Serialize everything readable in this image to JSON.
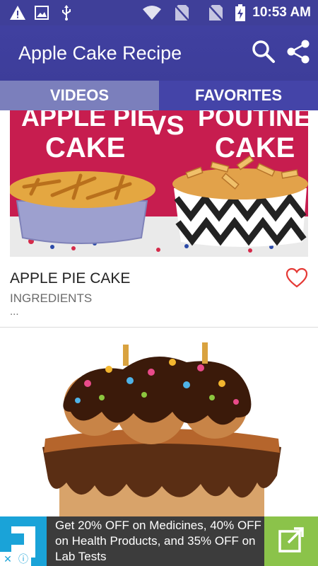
{
  "status_bar": {
    "time": "10:53 AM",
    "icons": [
      "warning-icon",
      "image-icon",
      "usb-icon",
      "wifi-icon",
      "no-sim-icon",
      "no-sim-icon",
      "battery-charging-icon"
    ]
  },
  "app_bar": {
    "title": "Apple Cake Recipe",
    "actions": [
      "search-icon",
      "share-icon"
    ]
  },
  "tabs": [
    {
      "label": "VIDEOS",
      "selected": false
    },
    {
      "label": "FAVORITES",
      "selected": true
    }
  ],
  "cards": [
    {
      "image_text": {
        "left_line1": "APPLE PIE",
        "left_line2": "CAKE",
        "vs": "VS",
        "right_line1": "POUTINE",
        "right_line2": "CAKE"
      },
      "title": "APPLE PIE CAKE",
      "subtitle": "INGREDIENTS",
      "ellipsis": "...",
      "favorite_icon": "heart-outline-icon"
    },
    {
      "image_description_icon": "cake-photo"
    }
  ],
  "ad": {
    "text": "Get 20% OFF on Medicines, 40% OFF on Health Products, and 35% OFF on Lab Tests",
    "close_icon": "close-icon",
    "info_icon": "info-icon",
    "open_icon": "open-external-icon"
  },
  "colors": {
    "primary": "#3f3f99",
    "tab_inactive": "#7b7fbc",
    "tab_active": "#4444a8",
    "accent_heart": "#e53935",
    "ad_logo": "#1aa3d8",
    "ad_open": "#8bc34a"
  }
}
